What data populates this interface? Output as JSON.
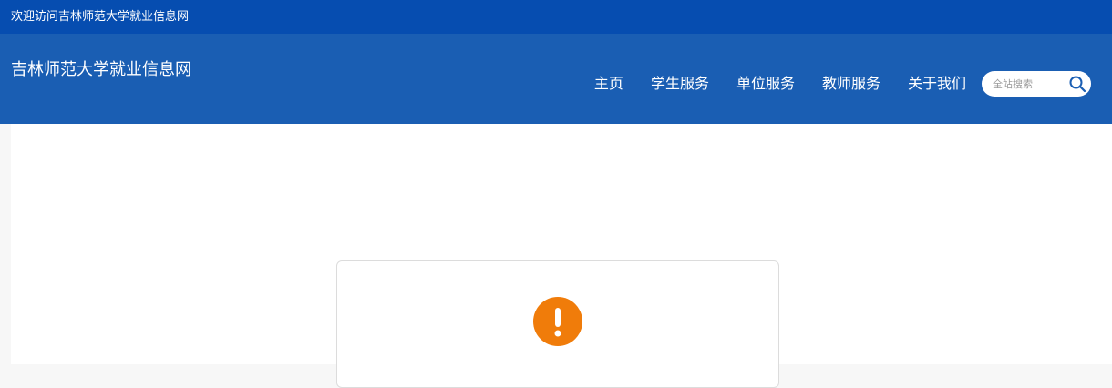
{
  "topbar": {
    "welcome_text": "欢迎访问吉林师范大学就业信息网"
  },
  "header": {
    "site_title": "吉林师范大学就业信息网",
    "nav": [
      {
        "label": "主页"
      },
      {
        "label": "学生服务"
      },
      {
        "label": "单位服务"
      },
      {
        "label": "教师服务"
      },
      {
        "label": "关于我们"
      }
    ],
    "search": {
      "placeholder": "全站搜索",
      "icon": "search-icon"
    }
  },
  "alert": {
    "icon": "exclamation-icon",
    "color": "#f07c0a"
  },
  "colors": {
    "topbar_bg": "#064db0",
    "header_bg": "#1a5eb3",
    "alert_orange": "#f07c0a"
  }
}
